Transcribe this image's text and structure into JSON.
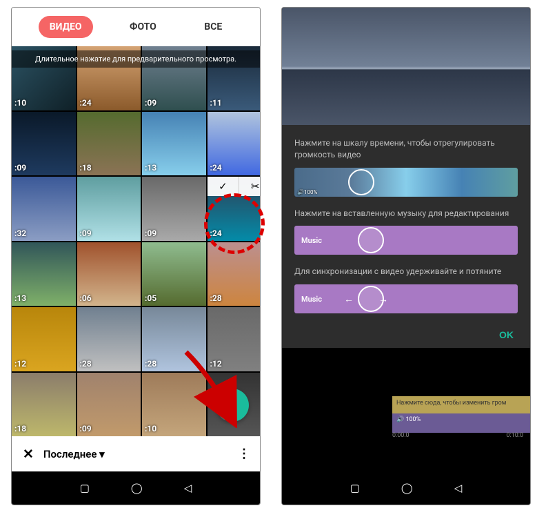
{
  "tabs": {
    "video": "ВИДЕО",
    "photo": "ФОТО",
    "all": "ВСЕ"
  },
  "hint": "Длительное нажатие для предварительного просмотра.",
  "durations": [
    ":10",
    ":24",
    ":09",
    ":11",
    ":09",
    ":18",
    ":13",
    ":24",
    ":32",
    ":09",
    ":09",
    ":24",
    ":13",
    ":06",
    ":05",
    ":28",
    ":12",
    ":28",
    ":28",
    ":12",
    ":18",
    ":09",
    ":10",
    ""
  ],
  "bottomBar": {
    "title": "Последнее ▾"
  },
  "dialog": {
    "t1": "Нажмите на шкалу времени, чтобы отрегулировать громкость видео",
    "t2": "Нажмите на вставленную музыку для редактирования",
    "t3": "Для синхронизации с видео удерживайте и потяните",
    "vol": "🔊100%",
    "music": "Music",
    "ok": "OK"
  },
  "editor": {
    "track1": "Нажмите сюда, чтобы изменить гром",
    "track2": "🔊 100%",
    "t0": "0:00:0",
    "t1": "0:10:0"
  }
}
